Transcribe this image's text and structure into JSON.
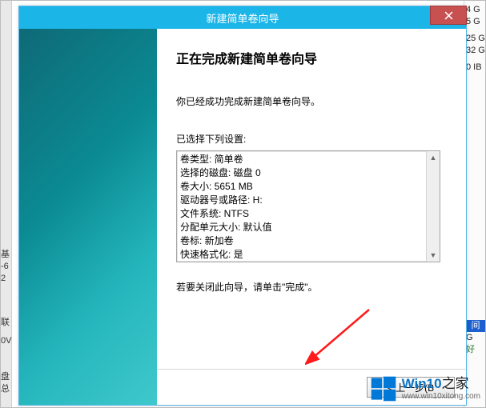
{
  "dialog": {
    "title": "新建简单卷向导",
    "heading": "正在完成新建简单卷向导",
    "successMsg": "你已经成功完成新建简单卷向导。",
    "settingsLabel": "已选择下列设置:",
    "hint": "若要关闭此向导，请单击\"完成\"。",
    "backBtn": "< 上一步(B",
    "settings": [
      "卷类型: 简单卷",
      "选择的磁盘: 磁盘 0",
      "卷大小: 5651 MB",
      "驱动器号或路径: H:",
      "文件系统: NTFS",
      "分配单元大小: 默认值",
      "卷标: 新加卷",
      "快速格式化: 是"
    ]
  },
  "background": {
    "leftFrags": [
      "基",
      "-6",
      "2",
      "联",
      "0V",
      "盘",
      "总"
    ],
    "rightFrags": [
      "4 G",
      "5 G",
      "25 G",
      "32 G",
      "0 IB"
    ],
    "rightHeader": "间",
    "rightBelow": [
      "G",
      "好"
    ]
  },
  "watermark": {
    "brand1": "Win10",
    "brand2": "之家",
    "url": "www.win10xitong.com"
  }
}
